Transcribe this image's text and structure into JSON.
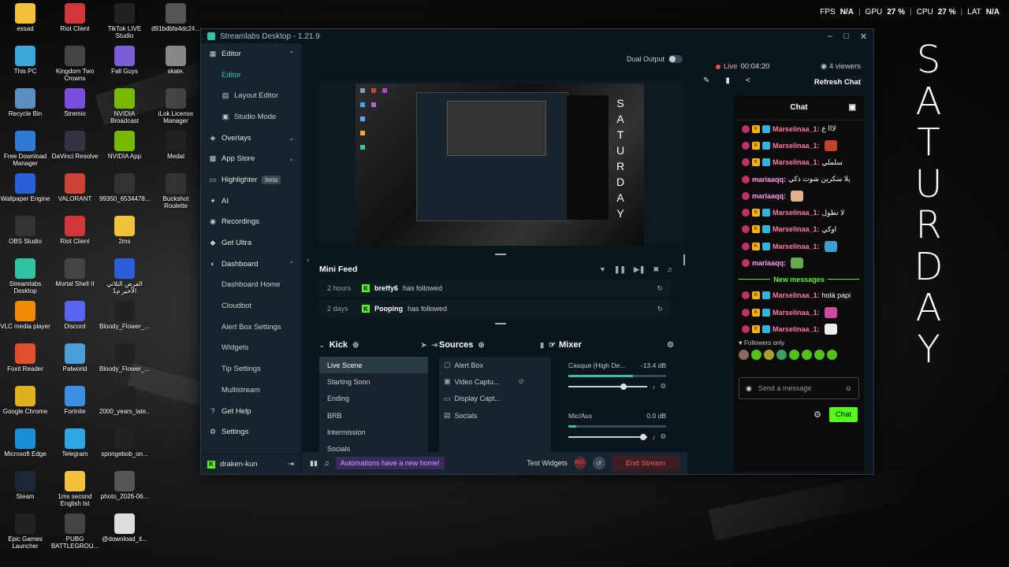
{
  "perf": {
    "fps_label": "FPS",
    "fps": "N/A",
    "gpu_label": "GPU",
    "gpu": "27 %",
    "cpu_label": "CPU",
    "cpu": "27 %",
    "lat_label": "LAT",
    "lat": "N/A"
  },
  "saturday": [
    "S",
    "A",
    "T",
    "U",
    "R",
    "D",
    "A",
    "Y"
  ],
  "desktop": [
    {
      "label": "essad",
      "color": "#f2c23a"
    },
    {
      "label": "Riot Client",
      "color": "#d1363a"
    },
    {
      "label": "TikTok LIVE Studio",
      "color": "#222"
    },
    {
      "label": "d91bdbfa4dc24...",
      "color": "#555"
    },
    {
      "label": "This PC",
      "color": "#3aa7d6"
    },
    {
      "label": "Kingdom Two Crowns",
      "color": "#444"
    },
    {
      "label": "Fall Guys",
      "color": "#7b5cd6"
    },
    {
      "label": "skate.",
      "color": "#888"
    },
    {
      "label": "Recycle Bin",
      "color": "#5a8fbf"
    },
    {
      "label": "Stremio",
      "color": "#7a4de0"
    },
    {
      "label": "NVIDIA Broadcast",
      "color": "#76b900"
    },
    {
      "label": "iLok License Manager",
      "color": "#444"
    },
    {
      "label": "Free Download Manager",
      "color": "#2e7bd6"
    },
    {
      "label": "DaVinci Resolve",
      "color": "#334"
    },
    {
      "label": "NVIDIA App",
      "color": "#76b900"
    },
    {
      "label": "Medal",
      "color": "#222"
    },
    {
      "label": "Wallpaper Engine",
      "color": "#2b5fd9"
    },
    {
      "label": "VALORANT",
      "color": "#c43"
    },
    {
      "label": "99350_6534478...",
      "color": "#333"
    },
    {
      "label": "Buckshot Roulette",
      "color": "#333"
    },
    {
      "label": "OBS Studio",
      "color": "#333"
    },
    {
      "label": "Riot Client",
      "color": "#d1363a"
    },
    {
      "label": "2ms",
      "color": "#f2c23a"
    },
    {
      "label": "",
      "color": "transparent"
    },
    {
      "label": "Streamlabs Desktop",
      "color": "#31c3a2"
    },
    {
      "label": "Mortal Shell II",
      "color": "#444"
    },
    {
      "label": "الفرض الثلاثي الأخير م1",
      "color": "#2b5fd9"
    },
    {
      "label": "",
      "color": "transparent"
    },
    {
      "label": "VLC media player",
      "color": "#f08a00"
    },
    {
      "label": "Discord",
      "color": "#5865f2"
    },
    {
      "label": "Bloody_Flower_...",
      "color": "#222"
    },
    {
      "label": "",
      "color": "transparent"
    },
    {
      "label": "Foxit Reader",
      "color": "#e2502b"
    },
    {
      "label": "Palworld",
      "color": "#4aa0d6"
    },
    {
      "label": "Bloody_Flower_...",
      "color": "#222"
    },
    {
      "label": "",
      "color": "transparent"
    },
    {
      "label": "Google Chrome",
      "color": "#e0b01e"
    },
    {
      "label": "Fortnite",
      "color": "#3a8fe0"
    },
    {
      "label": "2000_years_late...",
      "color": "#222"
    },
    {
      "label": "",
      "color": "transparent"
    },
    {
      "label": "Microsoft Edge",
      "color": "#1a8fd6"
    },
    {
      "label": "Telegram",
      "color": "#2ea6e0"
    },
    {
      "label": "spongebob_on...",
      "color": "#222"
    },
    {
      "label": "",
      "color": "transparent"
    },
    {
      "label": "Steam",
      "color": "#1b2838"
    },
    {
      "label": "1ms second English tst",
      "color": "#f2c23a"
    },
    {
      "label": "photo_2026-06...",
      "color": "#555"
    },
    {
      "label": "",
      "color": "transparent"
    },
    {
      "label": "Epic Games Launcher",
      "color": "#222"
    },
    {
      "label": "PUBG BATTLEGROU...",
      "color": "#444"
    },
    {
      "label": "@download_it...",
      "color": "#ddd"
    },
    {
      "label": "",
      "color": "transparent"
    }
  ],
  "window": {
    "title": "Streamlabs Desktop - 1.21.9",
    "nav": [
      {
        "label": "Editor",
        "icon": "grid-icon",
        "chev": "^",
        "sub": false
      },
      {
        "label": "Editor",
        "sub": true,
        "active": true
      },
      {
        "label": "Layout Editor",
        "sub": true,
        "icon": "layout-icon"
      },
      {
        "label": "Studio Mode",
        "sub": true,
        "icon": "studio-icon"
      },
      {
        "label": "Overlays",
        "icon": "overlay-icon",
        "chev": "v"
      },
      {
        "label": "App Store",
        "icon": "store-icon",
        "chev": "v"
      },
      {
        "label": "Highlighter",
        "icon": "highlighter-icon",
        "badge": "beta"
      },
      {
        "label": "AI",
        "icon": "ai-icon"
      },
      {
        "label": "Recordings",
        "icon": "record-icon"
      },
      {
        "label": "Get Ultra",
        "icon": "ultra-icon"
      },
      {
        "label": "Dashboard",
        "icon": "dashboard-icon",
        "chev": "^"
      },
      {
        "label": "Dashboard Home",
        "sub": true
      },
      {
        "label": "Cloudbot",
        "sub": true
      },
      {
        "label": "Alert Box Settings",
        "sub": true
      },
      {
        "label": "Widgets",
        "sub": true
      },
      {
        "label": "Tip Settings",
        "sub": true
      },
      {
        "label": "Multistream",
        "sub": true
      },
      {
        "label": "Get Help",
        "icon": "help-icon"
      },
      {
        "label": "Settings",
        "icon": "gear-icon"
      }
    ],
    "user": "draken-kun",
    "dual_output": "Dual Output",
    "preview_sat": [
      "S",
      "A",
      "T",
      "U",
      "R",
      "D",
      "A",
      "Y"
    ],
    "mini_feed": {
      "title": "Mini Feed",
      "items": [
        {
          "time": "2 hours",
          "user": "breffy6",
          "action": "has followed"
        },
        {
          "time": "2 days",
          "user": "Pooping",
          "action": "has followed"
        }
      ]
    },
    "scenes": {
      "title": "Kick",
      "items": [
        "Live Scene",
        "Starting Soon",
        "Ending",
        "BRB",
        "Intermission",
        "Socials"
      ]
    },
    "sources": {
      "title": "Sources",
      "items": [
        "Alert Box",
        "Video Captu...",
        "Display Capt...",
        "Socials"
      ]
    },
    "mixer": {
      "title": "Mixer",
      "items": [
        {
          "name": "Casque (High De...",
          "db": "-13.4 dB",
          "level": 0.66,
          "volume": 0.7
        },
        {
          "name": "Mic/Aux",
          "db": "0.0 dB",
          "level": 0.08,
          "volume": 0.95
        }
      ]
    },
    "bottom": {
      "automations": "Automations have a new home!",
      "test_widgets": "Test Widgets",
      "rec": "REC",
      "end_stream": "End Stream"
    }
  },
  "right": {
    "live_label": "Live",
    "live_time": "00:04:20",
    "viewers": "4 viewers",
    "refresh": "Refresh Chat",
    "chat_title": "Chat",
    "messages": [
      {
        "user": "Marselinaa_1:",
        "text": "لااا ع",
        "badges": true
      },
      {
        "user": "Marselinaa_1:",
        "text": "",
        "badges": true,
        "emote": "#c0442a"
      },
      {
        "user": "Marselinaa_1:",
        "text": "سلملي",
        "badges": true
      },
      {
        "user": "mariaaqq:",
        "text": "يلا سكرين شوت ذكي",
        "badges": false
      },
      {
        "user": "mariaaqq:",
        "text": "",
        "badges": false,
        "emote": "#e0b090"
      },
      {
        "user": "Marselinaa_1:",
        "text": "لا تطول",
        "badges": true
      },
      {
        "user": "Marselinaa_1:",
        "text": "اوكي",
        "badges": true
      },
      {
        "user": "Marselinaa_1:",
        "text": "",
        "badges": true,
        "emote": "#3aa0d0"
      },
      {
        "user": "mariaaqq:",
        "text": "",
        "badges": false,
        "emote": "#6aa84f"
      }
    ],
    "new_messages": "New messages",
    "messages2": [
      {
        "user": "Marselinaa_1:",
        "text": "holà papi",
        "badges": true
      },
      {
        "user": "Marselinaa_1:",
        "text": "",
        "badges": true,
        "emote": "#d04aa0"
      },
      {
        "user": "Marselinaa_1:",
        "text": "",
        "badges": true,
        "emote": "#eee"
      }
    ],
    "followers_only": "Followers only",
    "send_placeholder": "Send a message",
    "chat_button": "Chat"
  }
}
